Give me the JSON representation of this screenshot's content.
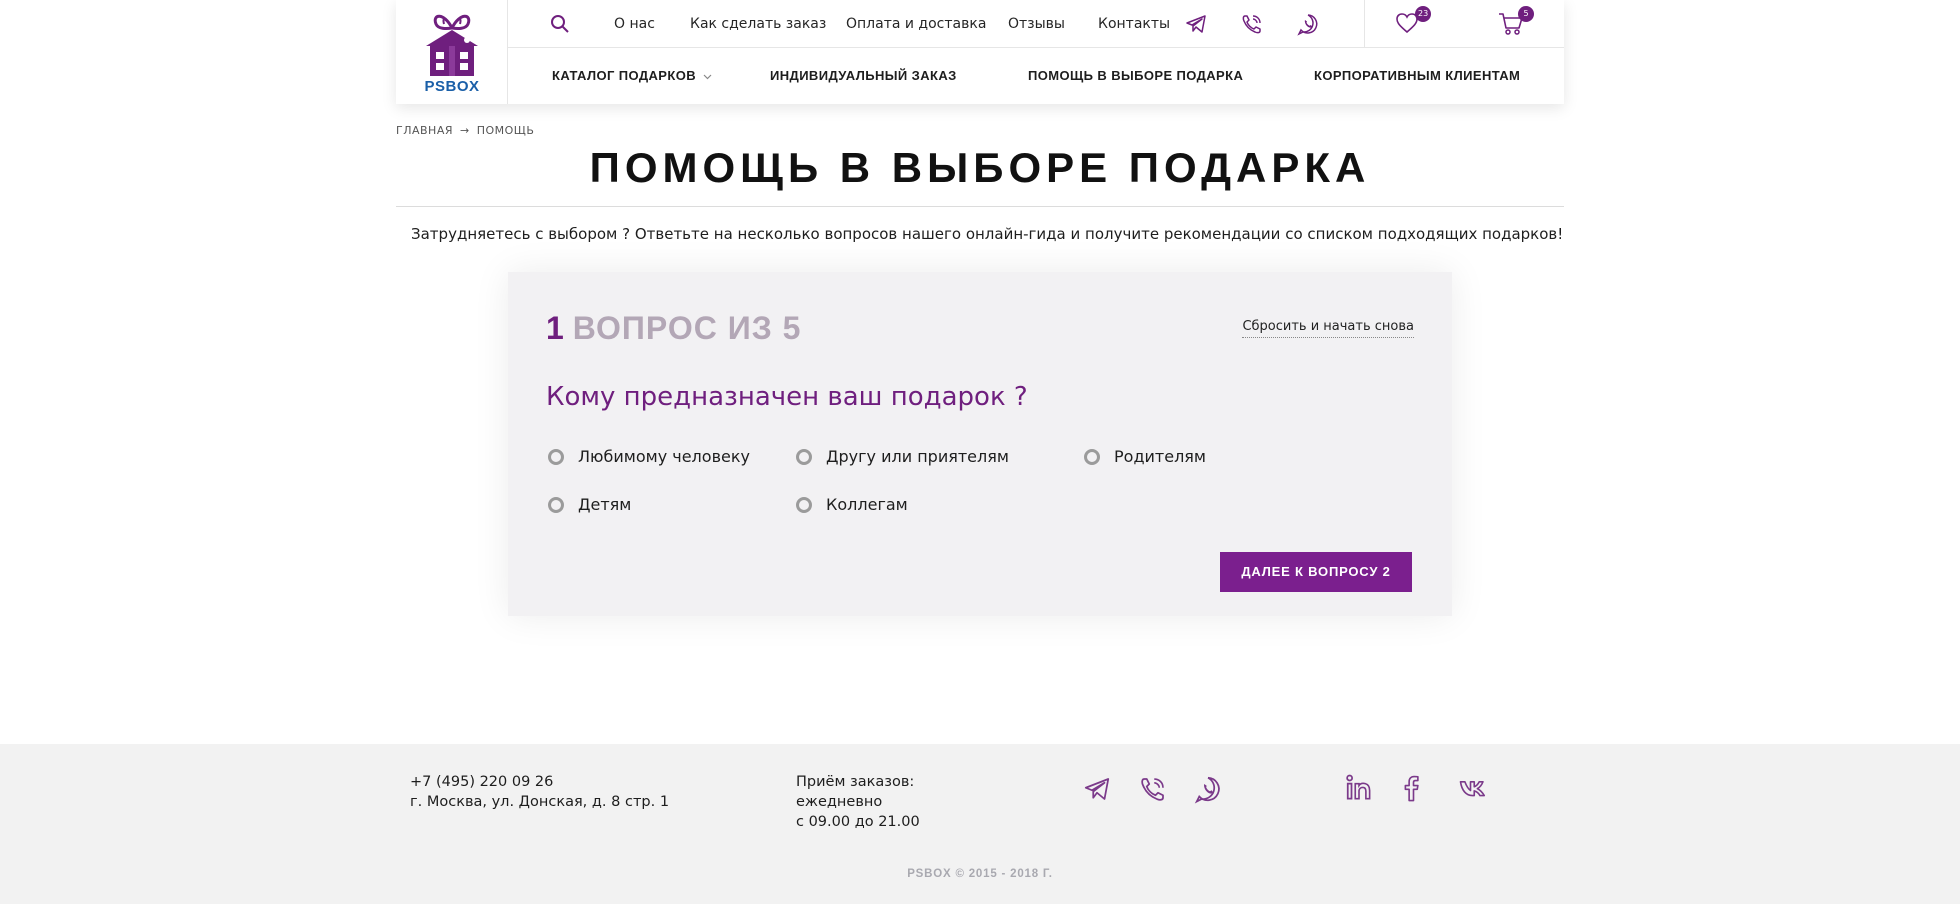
{
  "colors": {
    "brand": "#6f1f7e",
    "button": "#7b1f8e",
    "logo_text": "#1a5fa8",
    "muted": "#b3a7b6"
  },
  "header": {
    "logo_text": "PSBOX",
    "top_links": [
      "О нас",
      "Как сделать заказ",
      "Оплата и доставка",
      "Отзывы",
      "Контакты"
    ],
    "messenger_icons": [
      "telegram-icon",
      "viber-icon",
      "whatsapp-icon"
    ],
    "wishlist_count": "23",
    "cart_count": "5",
    "main_nav": [
      "КАТАЛОГ ПОДАРКОВ",
      "ИНДИВИДУАЛЬНЫЙ ЗАКАЗ",
      "ПОМОЩЬ В ВЫБОРЕ ПОДАРКА",
      "КОРПОРАТИВНЫМ КЛИЕНТАМ"
    ]
  },
  "breadcrumb": {
    "home": "ГЛАВНАЯ",
    "separator": "→",
    "current": "ПОМОЩЬ"
  },
  "page_title": "ПОМОЩЬ В ВЫБОРЕ ПОДАРКА",
  "intro": "Затрудняетесь с выбором ? Ответьте на несколько вопросов нашего онлайн-гида и получите рекомендации со списком подходящих подарков!",
  "quiz": {
    "step_number": "1",
    "step_text": "ВОПРОС ИЗ 5",
    "reset_label": "Сбросить и начать снова",
    "question": "Кому предназначен ваш подарок ?",
    "options": [
      "Любимому человеку",
      "Другу или приятелям",
      "Родителям",
      "Детям",
      "Коллегам"
    ],
    "next_label": "ДАЛЕЕ К ВОПРОСУ 2"
  },
  "footer": {
    "phone": "+7 (495) 220 09 26",
    "address": "г. Москва, ул. Донская, д. 8 стр. 1",
    "hours_title": "Приём заказов:",
    "hours_days": "ежедневно",
    "hours_time": "с 09.00 до 21.00",
    "messenger_icons": [
      "telegram-icon",
      "viber-icon",
      "whatsapp-icon"
    ],
    "social_icons": [
      "linkedin-icon",
      "facebook-icon",
      "vk-icon"
    ],
    "copyright": "PSBOX © 2015 - 2018 Г."
  }
}
